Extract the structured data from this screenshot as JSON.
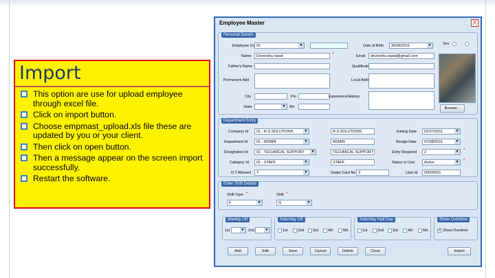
{
  "import_panel": {
    "title": "Import",
    "bullets": [
      "This option are use for upload employee through excel file.",
      "Click on import button.",
      "Choose empmast_upload.xls file these are updated by you or your client.",
      "Then click on open button.",
      "Then a message appear on the screen import successfully.",
      "Restart the software."
    ]
  },
  "window": {
    "title": "Employee Master",
    "close": "X",
    "personal": {
      "title": "Personal Details",
      "employee_code_label": "Employee Code",
      "employee_code": "01",
      "name_label": "Name",
      "name": "Devendra rawat",
      "fathers_name_label": "Father's Name",
      "permanent_add_label": "Permanent Add",
      "city_label": "City",
      "pin_label": "Pin",
      "state_label": "State",
      "date_of_birth_label": "Date of Birth",
      "date_of_birth": "30/06/2011",
      "email_label": "Email",
      "email": "devendra.rawat@gmail.com",
      "qualification_label": "Qualification",
      "local_address_label": "Local Address",
      "experience_label": "Experience/History",
      "sex_label": "Sex",
      "browse": "Browse .."
    },
    "department": {
      "title": "Department Entry",
      "company_label": "Company Id",
      "company_id": "01 - R.S.SOLUTIONS",
      "company_name": "R.S.SOLUTIONS",
      "dept_label": "Department Id",
      "dept_id": "01 - ADMIN",
      "dept_name": "ADMIN",
      "designation_label": "Designation Id",
      "designation_id": "01 - TECHNICAL SUPPORT",
      "designation_name": "TECHNICAL SUPPORT",
      "category_label": "Category Id",
      "category_id": "01 - STAFF",
      "category_name": "STAFF",
      "ot_label": "O.T Allowed",
      "ot_value": "Y",
      "swipe_label": "Swipe Card No",
      "swipe_value": "3",
      "joining_label": "Joining Date",
      "joining_date": "01/07/2011",
      "resign_label": "Resign Date",
      "resign_date": "07/08/2011",
      "entry_label": "Entry Required",
      "entry_value": "2",
      "status_label": "Status or Line",
      "status_value": "Active",
      "user_label": "User Id",
      "user_value": "00000001"
    },
    "shift": {
      "title": "Enter Shift Details",
      "shift_type_label": "Shift Type",
      "shift_type": "F",
      "shift_label": "Shift",
      "shift": "G"
    },
    "weekly": {
      "weekly_off_title": "Weekly Off",
      "saturday_off_title": "Saturday Off",
      "saturday_half_title": "Saturday Half Day",
      "show_overtime_title": "Show Overtime",
      "first": "1st",
      "second": "2nd",
      "checks": [
        "1st",
        "2nd",
        "3rd",
        "4th",
        "5th"
      ],
      "show_overtime_label": "Show Overtime"
    },
    "buttons": [
      "Add",
      "Edit",
      "Save",
      "Cancel",
      "Delete",
      "Close",
      "Import"
    ]
  }
}
